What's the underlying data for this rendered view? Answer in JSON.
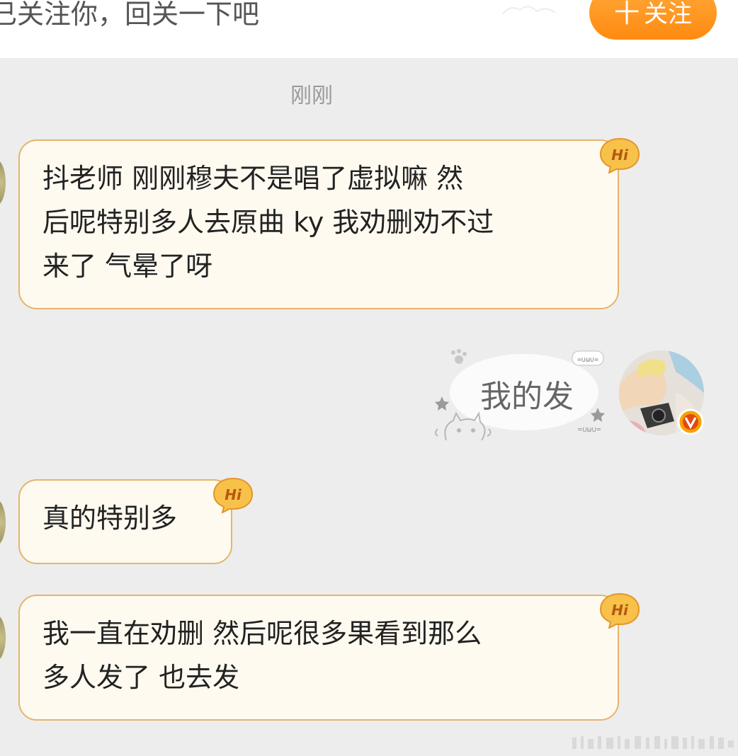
{
  "header": {
    "notice_text": "已关注你，回关一下吧",
    "follow_button_label": "十关注",
    "follow_button_plus": "十",
    "follow_button_text": "关注"
  },
  "chat": {
    "timestamp": "刚刚",
    "messages": [
      {
        "side": "left",
        "lines": [
          "抖老师 刚刚穆夫不是唱了虚拟嘛 然",
          "后呢特别多人去原曲 ky 我劝删劝不过",
          "来了 气晕了呀"
        ],
        "badge": "Hi"
      },
      {
        "side": "right",
        "text": "我的发"
      },
      {
        "side": "left",
        "lines": [
          "真的特别多"
        ],
        "badge": "Hi"
      },
      {
        "side": "left",
        "lines": [
          "我一直在劝删 然后呢很多果看到那么",
          "多人发了 也去发"
        ],
        "badge": "Hi"
      }
    ]
  },
  "colors": {
    "background": "#ededed",
    "bubble_fill": "#fffaf0",
    "bubble_border": "#e5b46b",
    "follow_button": "#ff9a22",
    "verified_badge": "#f5a300"
  },
  "icons": {
    "hi_badge": "hi-sticker-icon",
    "verified": "verified-v-icon",
    "cat_deco": "cat-sticker-icon"
  },
  "decor": {
    "kaomoji_top": "=∪ω∪=",
    "kaomoji_bottom": "=∪ω∪="
  }
}
